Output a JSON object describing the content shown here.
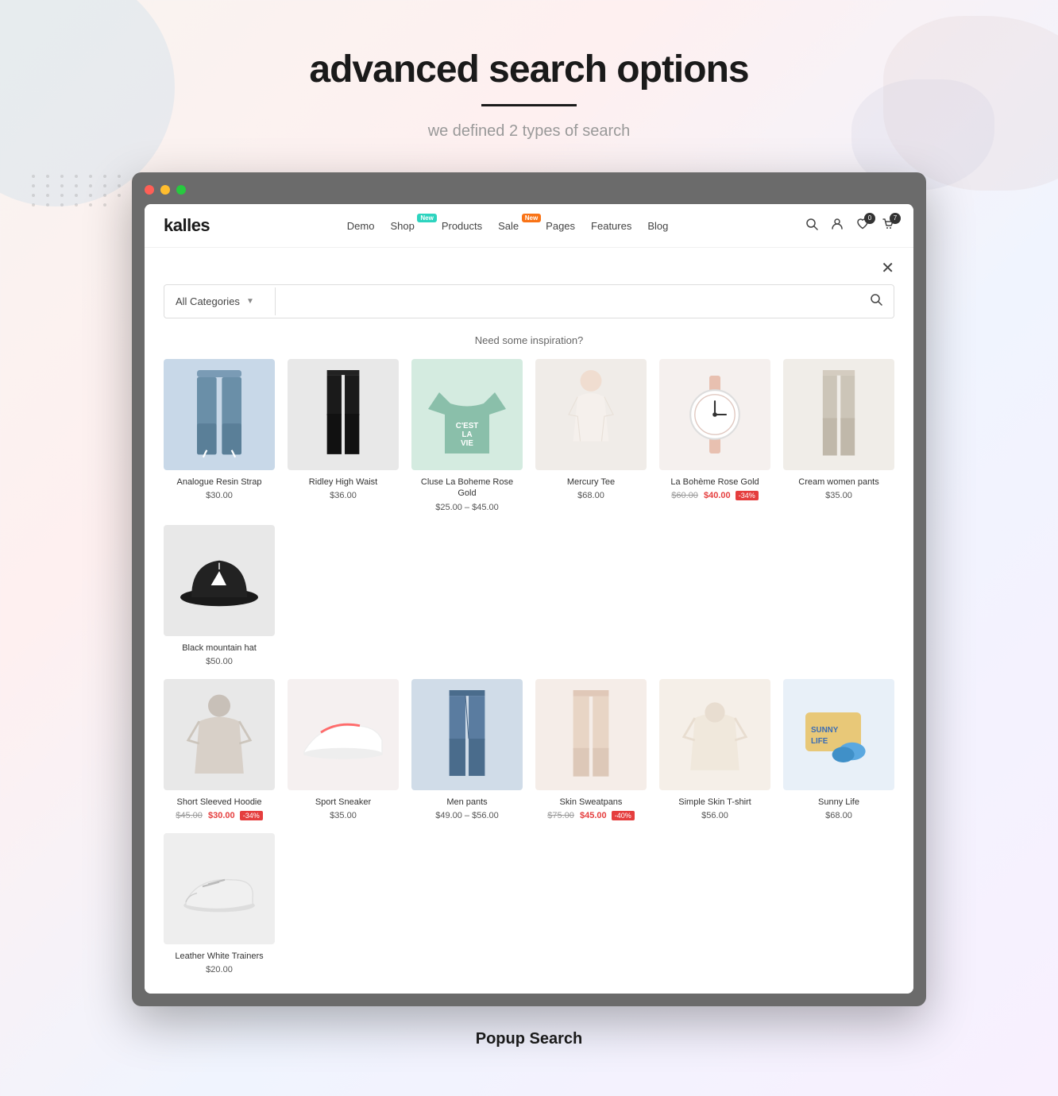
{
  "page": {
    "title": "advanced search  options",
    "divider": true,
    "subtitle": "we defined 2 types of search",
    "bottom_label": "Popup Search"
  },
  "store": {
    "logo": "kalles",
    "nav": [
      {
        "label": "Demo",
        "badge": null
      },
      {
        "label": "Shop",
        "badge": "New",
        "badge_color": "teal"
      },
      {
        "label": "Products",
        "badge": null
      },
      {
        "label": "Sale",
        "badge": "New",
        "badge_color": "orange"
      },
      {
        "label": "Pages",
        "badge": null
      },
      {
        "label": "Features",
        "badge": null
      },
      {
        "label": "Blog",
        "badge": null
      }
    ],
    "icons": [
      {
        "name": "search-icon",
        "symbol": "🔍",
        "badge": null
      },
      {
        "name": "user-icon",
        "symbol": "👤",
        "badge": null
      },
      {
        "name": "wishlist-icon",
        "symbol": "♡",
        "badge": "0"
      },
      {
        "name": "cart-icon",
        "symbol": "🛒",
        "badge": "7"
      }
    ]
  },
  "search": {
    "category_placeholder": "All Categories",
    "input_placeholder": "",
    "inspiration_label": "Need some inspiration?"
  },
  "products_row1": [
    {
      "name": "Analogue Resin Strap",
      "price": "$30.00",
      "original_price": null,
      "sale_badge": null,
      "color_class": "product-img-pants",
      "img_type": "pants"
    },
    {
      "name": "Ridley High Waist",
      "price": "$36.00",
      "original_price": null,
      "sale_badge": null,
      "color_class": "product-img-black-pants",
      "img_type": "black-pants"
    },
    {
      "name": "Cluse La Boheme Rose Gold",
      "price": "$25.00 – $45.00",
      "original_price": null,
      "sale_badge": null,
      "color_class": "product-img-tshirt",
      "img_type": "tshirt"
    },
    {
      "name": "Mercury Tee",
      "price": "$68.00",
      "original_price": null,
      "sale_badge": null,
      "color_class": "product-img-white-top",
      "img_type": "white-top"
    },
    {
      "name": "La Bohème Rose Gold",
      "price": "$40.00",
      "original_price": "$60.00",
      "sale_badge": "-34%",
      "color_class": "product-img-watch",
      "img_type": "watch"
    },
    {
      "name": "Cream women pants",
      "price": "$35.00",
      "original_price": null,
      "sale_badge": null,
      "color_class": "product-img-cream-pants",
      "img_type": "cream-pants"
    },
    {
      "name": "Black mountain hat",
      "price": "$50.00",
      "original_price": null,
      "sale_badge": null,
      "color_class": "product-img-hat",
      "img_type": "hat"
    }
  ],
  "products_row2": [
    {
      "name": "Short Sleeved Hoodie",
      "price": "$30.00",
      "original_price": "$45.00",
      "sale_badge": "-34%",
      "color_class": "product-img-hoodie",
      "img_type": "hoodie"
    },
    {
      "name": "Sport Sneaker",
      "price": "$35.00",
      "original_price": null,
      "sale_badge": null,
      "color_class": "product-img-sneaker",
      "img_type": "sneaker"
    },
    {
      "name": "Men pants",
      "price": "$49.00 – $56.00",
      "original_price": null,
      "sale_badge": null,
      "color_class": "product-img-jeans",
      "img_type": "jeans"
    },
    {
      "name": "Skin Sweatpans",
      "price": "$45.00",
      "original_price": "$75.00",
      "sale_badge": "-40%",
      "color_class": "product-img-skin-pants",
      "img_type": "skin-pants"
    },
    {
      "name": "Simple Skin T-shirt",
      "price": "$56.00",
      "original_price": null,
      "sale_badge": null,
      "color_class": "product-img-simple-tee",
      "img_type": "simple-tee"
    },
    {
      "name": "Sunny Life",
      "price": "$68.00",
      "original_price": null,
      "sale_badge": null,
      "color_class": "product-img-sunny",
      "img_type": "sunny"
    },
    {
      "name": "Leather White Trainers",
      "price": "$20.00",
      "original_price": null,
      "sale_badge": null,
      "color_class": "product-img-trainers",
      "img_type": "trainers"
    }
  ]
}
